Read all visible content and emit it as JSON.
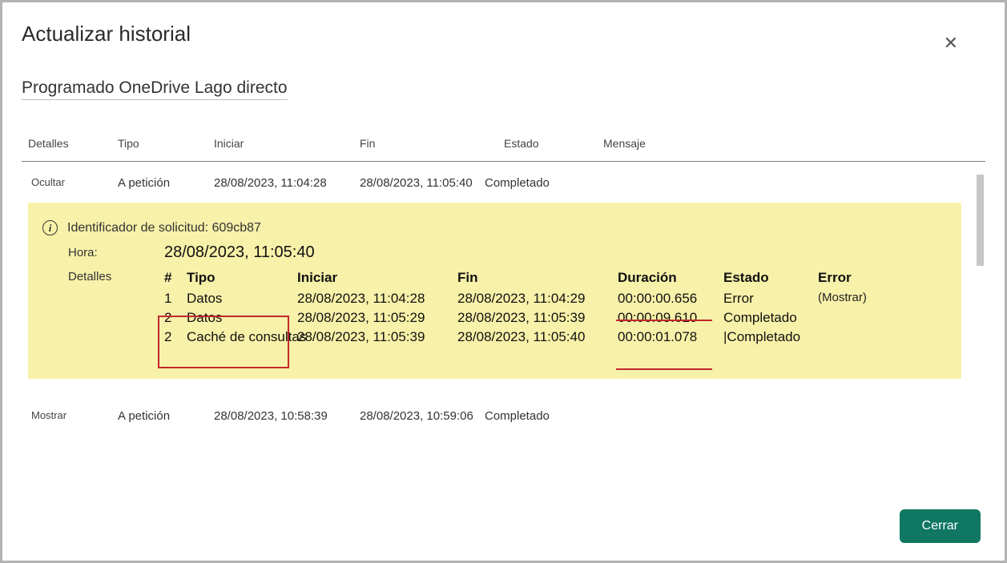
{
  "modal": {
    "title": "Actualizar historial",
    "subtitle": "Programado OneDrive Lago directo",
    "close_label": "✕"
  },
  "outer_header": {
    "detalles": "Detalles",
    "tipo": "Tipo",
    "iniciar": "Iniciar",
    "fin": "Fin",
    "estado": "Estado",
    "mensaje": "Mensaje"
  },
  "rows": [
    {
      "toggle": "Ocultar",
      "tipo": "A petición",
      "iniciar": "28/08/2023, 11:04:28",
      "fin": "28/08/2023, 11:05:40",
      "estado": "Completado",
      "mensaje": ""
    },
    {
      "toggle": "Mostrar",
      "tipo": "A petición",
      "iniciar": "28/08/2023, 10:58:39",
      "fin": "28/08/2023, 10:59:06",
      "estado": "Completado",
      "mensaje": ""
    }
  ],
  "panel": {
    "request_label": "Identificador de solicitud:",
    "request_id": "609cb87",
    "time_label": "Hora:",
    "time_value": "28/08/2023, 11:05:40",
    "details_label": "Detalles",
    "inner_header": {
      "num": "#",
      "tipo": "Tipo",
      "iniciar": "Iniciar",
      "fin": "Fin",
      "duracion": "Duración",
      "estado": "Estado",
      "error": "Error"
    },
    "inner_rows": [
      {
        "num": "1",
        "tipo": "Datos",
        "ini": "28/08/2023, 11:04:28",
        "fin": "28/08/2023, 11:04:29",
        "dur": "00:00:00.656",
        "est": "Error",
        "err": "(Mostrar)"
      },
      {
        "num": "2",
        "tipo": "Datos",
        "ini": "28/08/2023, 11:05:29",
        "fin": "28/08/2023, 11:05:39",
        "dur": "00:00:09.610",
        "est": "Completado",
        "err": ""
      },
      {
        "num": "2",
        "tipo": "Caché de consultas",
        "ini": "28/08/2023, 11:05:39",
        "fin": "28/08/2023, 11:05:40",
        "dur": "00:00:01.078",
        "est": "|Completado",
        "err": ""
      }
    ]
  },
  "footer": {
    "close_button": "Cerrar"
  }
}
